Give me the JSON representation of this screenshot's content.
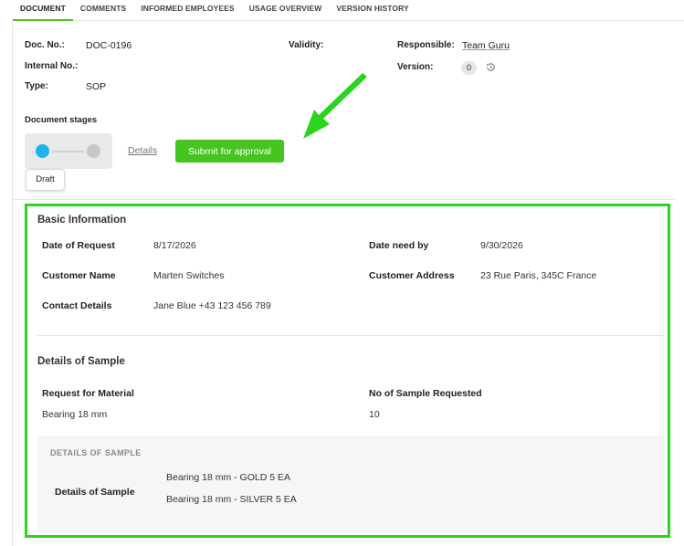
{
  "tabs": [
    {
      "label": "DOCUMENT",
      "active": true
    },
    {
      "label": "COMMENTS",
      "active": false
    },
    {
      "label": "INFORMED EMPLOYEES",
      "active": false
    },
    {
      "label": "USAGE OVERVIEW",
      "active": false
    },
    {
      "label": "VERSION HISTORY",
      "active": false
    }
  ],
  "meta": {
    "doc_no_label": "Doc. No.:",
    "doc_no_value": "DOC-0196",
    "internal_no_label": "Internal No.:",
    "type_label": "Type:",
    "type_value": "SOP",
    "validity_label": "Validity:",
    "responsible_label": "Responsible:",
    "responsible_value": "Team Guru",
    "version_label": "Version:",
    "version_value": "0",
    "history_icon": "history-icon"
  },
  "stages": {
    "title": "Document stages",
    "current_stage": "Draft",
    "details_link": "Details",
    "submit_label": "Submit for approval",
    "active_color": "#1ab4ee",
    "button_color": "#46c41f"
  },
  "annotation": {
    "arrow_icon": "pointer-arrow-icon",
    "color": "#2bd41d"
  },
  "basic_info": {
    "title": "Basic Information",
    "date_of_request_label": "Date of Request",
    "date_of_request_value": "8/17/2026",
    "date_need_by_label": "Date need by",
    "date_need_by_value": "9/30/2026",
    "customer_name_label": "Customer Name",
    "customer_name_value": "Marten Switches",
    "customer_address_label": "Customer Address",
    "customer_address_value": "23 Rue Paris, 345C France",
    "contact_details_label": "Contact Details",
    "contact_details_value": "Jane Blue +43 123 456 789"
  },
  "sample": {
    "title": "Details of Sample",
    "request_material_label": "Request for Material",
    "request_material_value": "Bearing 18 mm",
    "no_sample_label": "No of Sample Requested",
    "no_sample_value": "10",
    "panel_title": "DETAILS OF SAMPLE",
    "panel_label": "Details of Sample",
    "items": [
      "Bearing 18 mm - GOLD 5 EA",
      "Bearing 18 mm - SILVER 5 EA"
    ]
  }
}
